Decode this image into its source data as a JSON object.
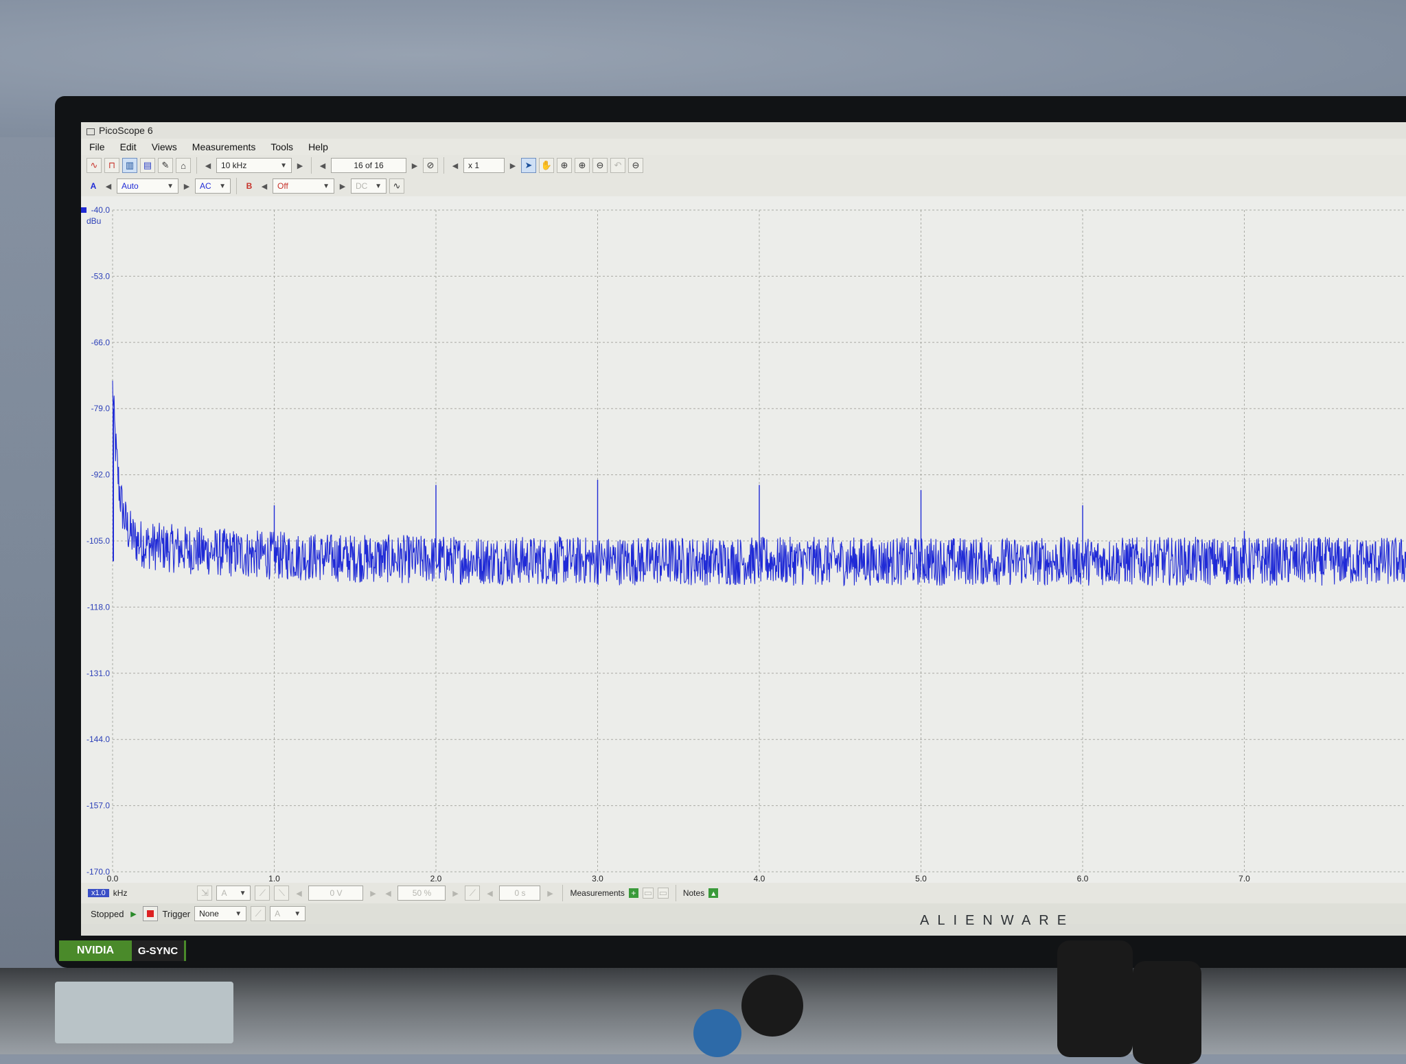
{
  "window": {
    "title": "PicoScope 6"
  },
  "menu": [
    "File",
    "Edit",
    "Views",
    "Measurements",
    "Tools",
    "Help"
  ],
  "toolbar": {
    "timebase": "10 kHz",
    "buffer": "16 of 16",
    "zoom": "x 1"
  },
  "channels": {
    "a": {
      "label": "A",
      "range": "Auto",
      "coupling": "AC"
    },
    "b": {
      "label": "B",
      "range": "Off",
      "coupling": "DC"
    }
  },
  "status": {
    "scale": "x1.0",
    "unit": "kHz",
    "voltage": "0 V",
    "percent": "50 %",
    "time": "0 s",
    "measurements": "Measurements",
    "notes": "Notes"
  },
  "run": {
    "state": "Stopped",
    "trigger_label": "Trigger",
    "trigger_mode": "None",
    "trigger_channel": "A"
  },
  "monitor": {
    "brand": "ALIENWARE",
    "badge_nvidia": "NVIDIA",
    "badge_gsync": "G-SYNC"
  },
  "chart_data": {
    "type": "line",
    "title": "",
    "xlabel": "kHz",
    "ylabel": "dBu",
    "xlim": [
      0,
      8
    ],
    "ylim": [
      -170,
      -40
    ],
    "y_ticks": [
      "-40.0",
      "-53.0",
      "-66.0",
      "-79.0",
      "-92.0",
      "-105.0",
      "-118.0",
      "-131.0",
      "-144.0",
      "-157.0",
      "-170.0"
    ],
    "x_ticks": [
      "0.0",
      "1.0",
      "2.0",
      "3.0",
      "4.0",
      "5.0",
      "6.0",
      "7.0"
    ],
    "grid": true,
    "series": [
      {
        "color": "#1f2ad6",
        "noise_floor_db": -109,
        "noise_spread_db": 6,
        "dc_peak_db": -79,
        "harmonic_peaks": [
          {
            "x": 1.0,
            "y": -98
          },
          {
            "x": 2.0,
            "y": -94
          },
          {
            "x": 3.0,
            "y": -93
          },
          {
            "x": 4.0,
            "y": -94
          },
          {
            "x": 5.0,
            "y": -95
          },
          {
            "x": 6.0,
            "y": -98
          },
          {
            "x": 7.0,
            "y": -103
          }
        ]
      }
    ]
  }
}
